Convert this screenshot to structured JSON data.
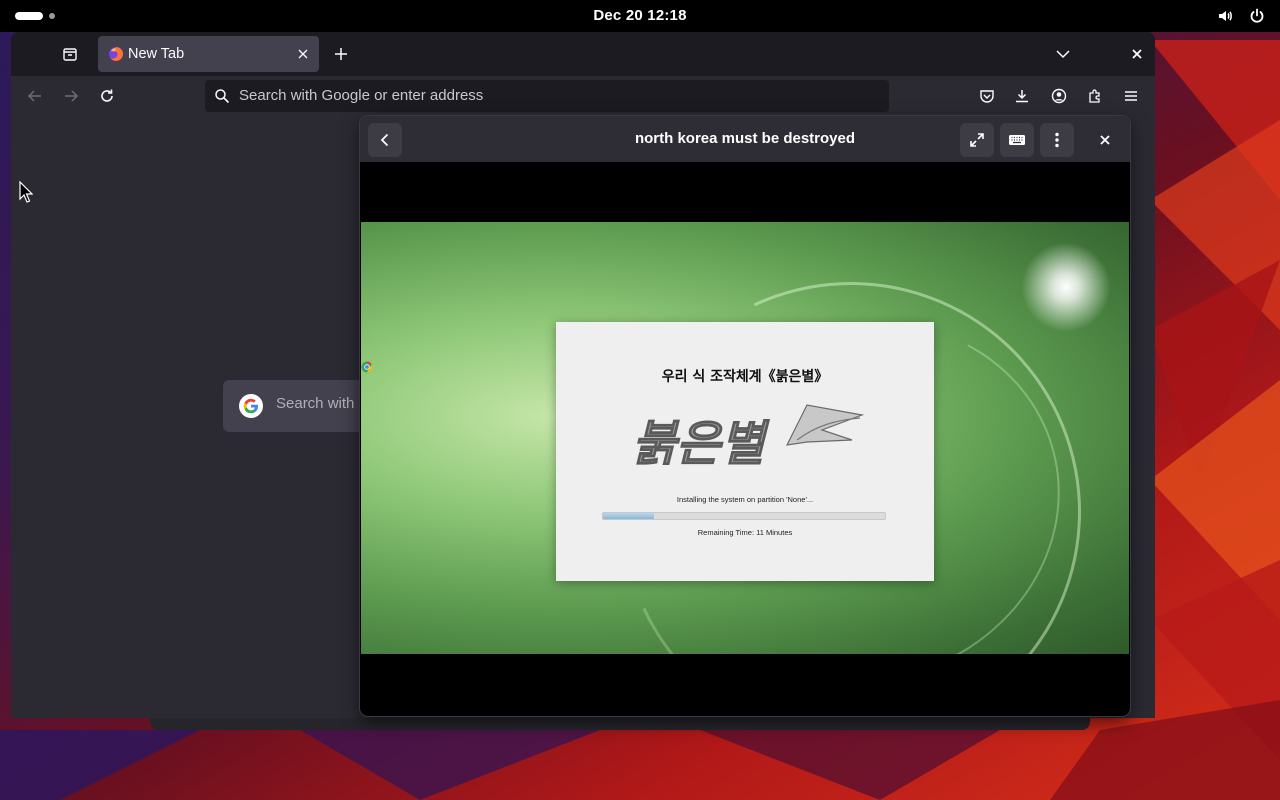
{
  "topbar": {
    "clock": "Dec 20  12:18",
    "icons": [
      "activities-indicator",
      "volume-icon",
      "power-icon"
    ]
  },
  "browser": {
    "tab": {
      "title": "New Tab",
      "favicon": "firefox-icon"
    },
    "urlbar": {
      "placeholder": "Search with Google or enter address"
    },
    "content": {
      "google_search_placeholder": "Search with Google"
    },
    "toolbar_icons": [
      "pocket-icon",
      "downloads-icon",
      "account-icon",
      "extensions-icon",
      "menu-icon"
    ],
    "colors": {
      "chrome": "#1c1b22",
      "toolbar": "#2b2a33",
      "tab_active": "#42414d"
    }
  },
  "viewer": {
    "title": "north korea must be destroyed",
    "buttons": [
      "back-button",
      "fullscreen-button",
      "keyboard-button",
      "menu-button",
      "close-button"
    ]
  },
  "installer": {
    "title": "우리 식 조작체계《붉은별》",
    "logo_text": "붉은별",
    "status": "Installing the system on partition 'None'...",
    "progress_fraction": 0.18,
    "remaining": "Remaining Time: 11 Minutes"
  }
}
